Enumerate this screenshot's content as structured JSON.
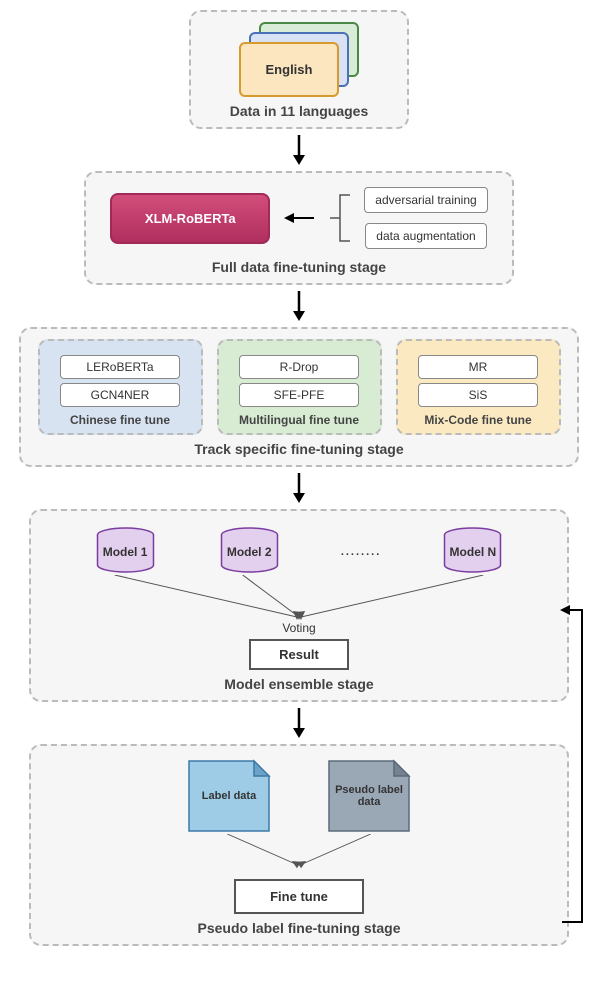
{
  "stage1": {
    "label": "Data in 11 languages",
    "card_label": "English"
  },
  "stage2": {
    "label": "Full data fine-tuning stage",
    "model": "XLM-RoBERTa",
    "opt1": "adversarial training",
    "opt2": "data augmentation"
  },
  "stage3": {
    "label": "Track specific fine-tuning stage",
    "chinese": {
      "title": "Chinese fine tune",
      "a": "LERoBERTa",
      "b": "GCN4NER"
    },
    "multi": {
      "title": "Multilingual fine tune",
      "a": "R-Drop",
      "b": "SFE-PFE"
    },
    "mix": {
      "title": "Mix-Code fine tune",
      "a": "MR",
      "b": "SiS"
    }
  },
  "stage4": {
    "label": "Model ensemble stage",
    "m1": "Model 1",
    "m2": "Model 2",
    "mn": "Model N",
    "dots": "........",
    "voting": "Voting",
    "result": "Result"
  },
  "stage5": {
    "label": "Pseudo label fine-tuning stage",
    "labeldata": "Label data",
    "pseudodata": "Pseudo label data",
    "finetune": "Fine tune"
  }
}
